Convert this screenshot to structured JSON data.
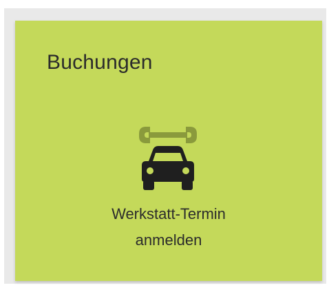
{
  "tile": {
    "title": "Buchungen",
    "icon": "car-repair-icon",
    "label_line1": "Werkstatt-Termin",
    "label_line2": "anmelden"
  },
  "colors": {
    "tile_background": "#c4d95a",
    "frame_background": "#e9e9e9",
    "icon_primary": "#1f1f1f",
    "icon_secondary": "#8a9a3c",
    "text": "#2b2b2b"
  }
}
